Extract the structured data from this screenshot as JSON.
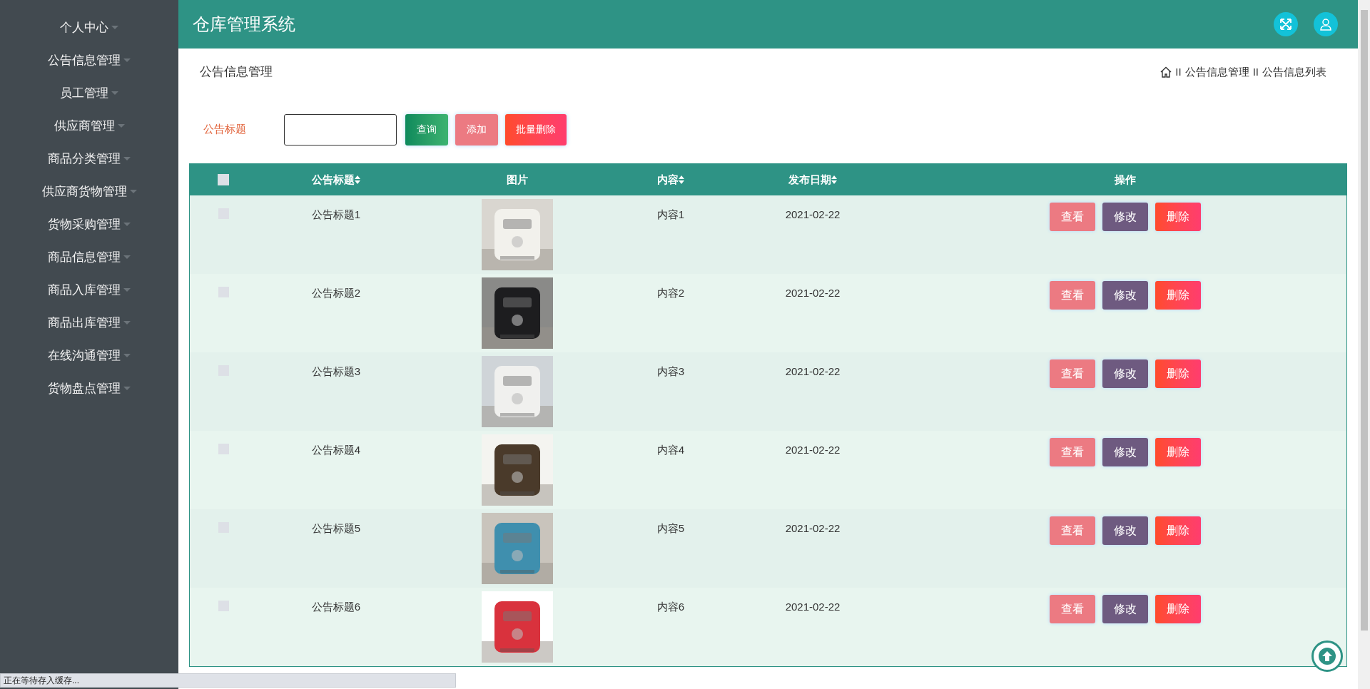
{
  "sidebar": {
    "items": [
      {
        "label": "个人中心"
      },
      {
        "label": "公告信息管理"
      },
      {
        "label": "员工管理"
      },
      {
        "label": "供应商管理"
      },
      {
        "label": "商品分类管理"
      },
      {
        "label": "供应商货物管理"
      },
      {
        "label": "货物采购管理"
      },
      {
        "label": "商品信息管理"
      },
      {
        "label": "商品入库管理"
      },
      {
        "label": "商品出库管理"
      },
      {
        "label": "在线沟通管理"
      },
      {
        "label": "货物盘点管理"
      }
    ]
  },
  "header": {
    "title": "仓库管理系统"
  },
  "page": {
    "title": "公告信息管理",
    "breadcrumb": [
      {
        "separator": "II",
        "label": "公告信息管理"
      },
      {
        "separator": "II",
        "label": "公告信息列表"
      }
    ]
  },
  "search": {
    "label": "公告标题",
    "buttons": [
      {
        "label": "查询",
        "kind": "search"
      },
      {
        "label": "添加",
        "kind": "add"
      },
      {
        "label": "批量删除",
        "kind": "bulk-delete"
      }
    ]
  },
  "table": {
    "all_checked": false,
    "columns": [
      {
        "label": "公告标题",
        "sortable": true
      },
      {
        "label": "图片",
        "sortable": false
      },
      {
        "label": "内容",
        "sortable": true
      },
      {
        "label": "发布日期",
        "sortable": true
      },
      {
        "label": "操作",
        "sortable": false
      }
    ],
    "rows": [
      {
        "checked": false,
        "title": "公告标题1",
        "content": "内容1",
        "date": "2021-02-22",
        "actions": [
          {
            "label": "查看",
            "kind": "view"
          },
          {
            "label": "修改",
            "kind": "edit"
          },
          {
            "label": "删除",
            "kind": "delete"
          }
        ]
      },
      {
        "checked": false,
        "title": "公告标题2",
        "content": "内容2",
        "date": "2021-02-22",
        "actions": [
          {
            "label": "查看",
            "kind": "view"
          },
          {
            "label": "修改",
            "kind": "edit"
          },
          {
            "label": "删除",
            "kind": "delete"
          }
        ]
      },
      {
        "checked": false,
        "title": "公告标题3",
        "content": "内容3",
        "date": "2021-02-22",
        "actions": [
          {
            "label": "查看",
            "kind": "view"
          },
          {
            "label": "修改",
            "kind": "edit"
          },
          {
            "label": "删除",
            "kind": "delete"
          }
        ]
      },
      {
        "checked": false,
        "title": "公告标题4",
        "content": "内容4",
        "date": "2021-02-22",
        "actions": [
          {
            "label": "查看",
            "kind": "view"
          },
          {
            "label": "修改",
            "kind": "edit"
          },
          {
            "label": "删除",
            "kind": "delete"
          }
        ]
      },
      {
        "checked": false,
        "title": "公告标题5",
        "content": "内容5",
        "date": "2021-02-22",
        "actions": [
          {
            "label": "查看",
            "kind": "view"
          },
          {
            "label": "修改",
            "kind": "edit"
          },
          {
            "label": "删除",
            "kind": "delete"
          }
        ]
      },
      {
        "checked": false,
        "title": "公告标题6",
        "content": "内容6",
        "date": "2021-02-22",
        "actions": [
          {
            "label": "查看",
            "kind": "view"
          },
          {
            "label": "修改",
            "kind": "edit"
          },
          {
            "label": "删除",
            "kind": "delete"
          }
        ]
      }
    ]
  },
  "status_bar": {
    "text": "正在等待存入缓存..."
  }
}
